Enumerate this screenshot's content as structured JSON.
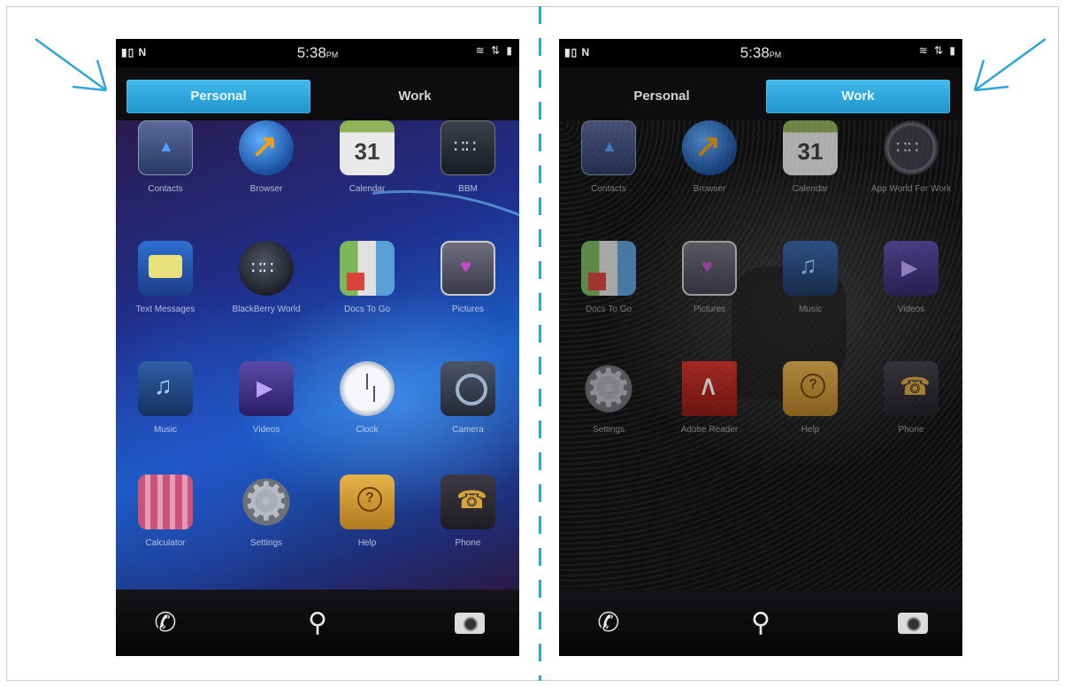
{
  "colors": {
    "accent": "#2ea6d6",
    "active_tab": "#2fa8de"
  },
  "left_phone": {
    "status": {
      "left": "▮▯ N",
      "time": "5:38",
      "time_suffix": "PM",
      "right": "≋ ⇅ ▮"
    },
    "tabs": [
      {
        "label": "Personal",
        "active": true
      },
      {
        "label": "Work",
        "active": false
      }
    ],
    "apps": [
      {
        "label": "Contacts",
        "icon": "contacts-icon"
      },
      {
        "label": "Browser",
        "icon": "browser-icon"
      },
      {
        "label": "Calendar",
        "icon": "calendar-icon"
      },
      {
        "label": "BBM",
        "icon": "bbm-icon"
      },
      {
        "label": "Text Messages",
        "icon": "text-messages-icon"
      },
      {
        "label": "BlackBerry World",
        "icon": "blackberry-world-icon"
      },
      {
        "label": "Docs To Go",
        "icon": "docs-to-go-icon"
      },
      {
        "label": "Pictures",
        "icon": "pictures-icon"
      },
      {
        "label": "Music",
        "icon": "music-icon"
      },
      {
        "label": "Videos",
        "icon": "videos-icon"
      },
      {
        "label": "Clock",
        "icon": "clock-icon"
      },
      {
        "label": "Camera",
        "icon": "camera-icon"
      },
      {
        "label": "Calculator",
        "icon": "calculator-icon"
      },
      {
        "label": "Settings",
        "icon": "settings-icon"
      },
      {
        "label": "Help",
        "icon": "help-icon"
      },
      {
        "label": "Phone",
        "icon": "phone-icon"
      }
    ],
    "dock": [
      "phone-icon",
      "search-icon",
      "camera-icon"
    ]
  },
  "right_phone": {
    "status": {
      "left": "▮▯ N",
      "time": "5:38",
      "time_suffix": "PM",
      "right": "≋ ⇅ ▮"
    },
    "tabs": [
      {
        "label": "Personal",
        "active": false
      },
      {
        "label": "Work",
        "active": true
      }
    ],
    "apps": [
      {
        "label": "Contacts",
        "icon": "contacts-icon"
      },
      {
        "label": "Browser",
        "icon": "browser-icon"
      },
      {
        "label": "Calendar",
        "icon": "calendar-icon"
      },
      {
        "label": "App World For Work",
        "icon": "app-world-icon"
      },
      {
        "label": "Docs To Go",
        "icon": "docs-to-go-icon"
      },
      {
        "label": "Pictures",
        "icon": "pictures-icon"
      },
      {
        "label": "Music",
        "icon": "music-icon"
      },
      {
        "label": "Videos",
        "icon": "videos-icon"
      },
      {
        "label": "Settings",
        "icon": "settings-icon"
      },
      {
        "label": "Adobe Reader",
        "icon": "adobe-reader-icon"
      },
      {
        "label": "Help",
        "icon": "help-icon"
      },
      {
        "label": "Phone",
        "icon": "phone-icon"
      }
    ],
    "dock": [
      "phone-icon",
      "search-icon",
      "camera-icon"
    ]
  }
}
